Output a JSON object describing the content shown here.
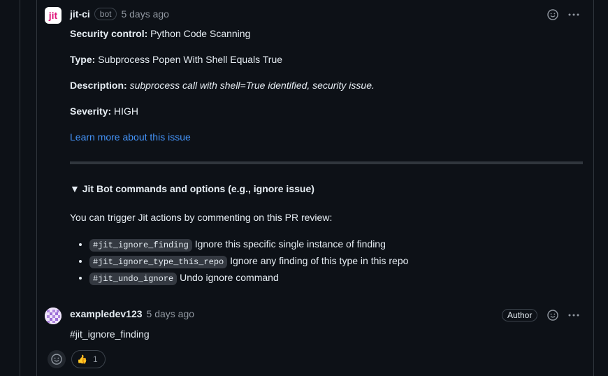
{
  "comment1": {
    "author": "jit-ci",
    "bot_badge": "bot",
    "time": "5 days ago",
    "avatar_text": "jit",
    "security_control_label": "Security control:",
    "security_control_value": "Python Code Scanning",
    "type_label": "Type:",
    "type_value": "Subprocess Popen With Shell Equals True",
    "description_label": "Description:",
    "description_value": "subprocess call with shell=True identified, security issue.",
    "severity_label": "Severity:",
    "severity_value": "HIGH",
    "learn_more": "Learn more about this issue",
    "summary": "▼ Jit Bot commands and options (e.g., ignore issue)",
    "intro": "You can trigger Jit actions by commenting on this PR review:",
    "commands": [
      {
        "code": "#jit_ignore_finding",
        "text": " Ignore this specific single instance of finding"
      },
      {
        "code": "#jit_ignore_type_this_repo",
        "text": " Ignore any finding of this type in this repo"
      },
      {
        "code": "#jit_undo_ignore",
        "text": " Undo ignore command"
      }
    ]
  },
  "comment2": {
    "author": "exampledev123",
    "time": "5 days ago",
    "author_badge": "Author",
    "body": "#jit_ignore_finding",
    "reaction_emoji": "👍",
    "reaction_count": "1"
  },
  "icons": [
    "smiley-icon",
    "kebab-icon"
  ]
}
